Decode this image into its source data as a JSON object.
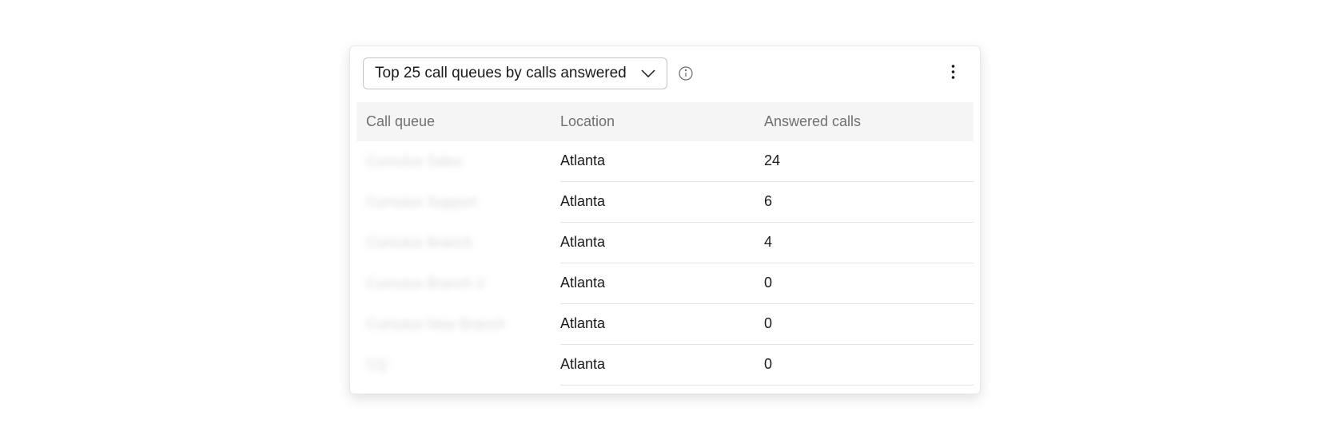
{
  "dropdown": {
    "selected_label": "Top 25 call queues by calls answered"
  },
  "table": {
    "headers": {
      "queue": "Call queue",
      "location": "Location",
      "answered": "Answered calls"
    },
    "rows": [
      {
        "queue": "Cumulus Sales",
        "location": "Atlanta",
        "answered": "24"
      },
      {
        "queue": "Cumulus Support",
        "location": "Atlanta",
        "answered": "6"
      },
      {
        "queue": "Cumulus Branch",
        "location": "Atlanta",
        "answered": "4"
      },
      {
        "queue": "Cumulus Branch 2",
        "location": "Atlanta",
        "answered": "0"
      },
      {
        "queue": "Cumulus New Branch",
        "location": "Atlanta",
        "answered": "0"
      },
      {
        "queue": "CQ",
        "location": "Atlanta",
        "answered": "0"
      }
    ]
  }
}
